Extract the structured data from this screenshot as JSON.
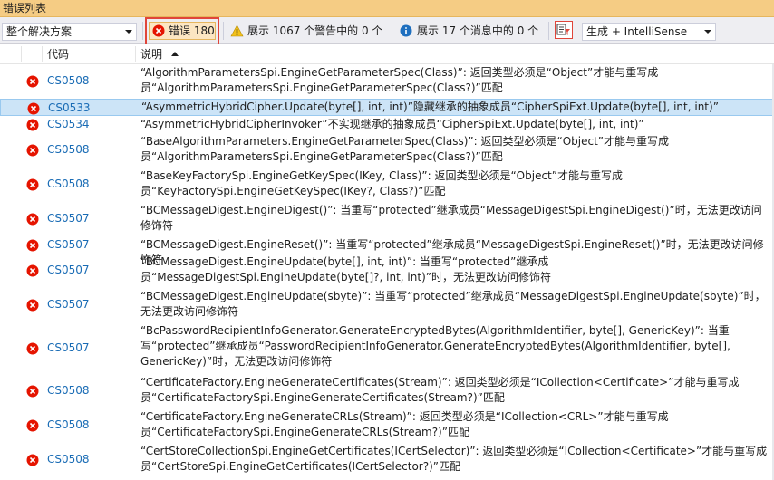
{
  "window": {
    "title": "错误列表"
  },
  "toolbar": {
    "scope_select": "整个解决方案",
    "errors_label": "错误 180",
    "warnings_label": "展示 1067 个警告中的 0 个",
    "messages_label": "展示 17 个消息中的 0 个",
    "build_select": "生成 + IntelliSense"
  },
  "columns": {
    "code": "代码",
    "description": "说明"
  },
  "colors": {
    "accent_title": "#f5cc84",
    "selected_row": "#cce4f7",
    "error_red": "#e51400",
    "link_blue": "#1a6cb5"
  },
  "rows": [
    {
      "code": "CS0508",
      "description": "“AlgorithmParametersSpi.EngineGetParameterSpec(Class)”: 返回类型必须是“Object”才能与重写成员“AlgorithmParametersSpi.EngineGetParameterSpec(Class?)”匹配"
    },
    {
      "code": "CS0533",
      "description": "“AsymmetricHybridCipher.Update(byte[], int, int)”隐藏继承的抽象成员“CipherSpiExt.Update(byte[], int, int)”"
    },
    {
      "code": "CS0534",
      "description": "“AsymmetricHybridCipherInvoker”不实现继承的抽象成员“CipherSpiExt.Update(byte[], int, int)”"
    },
    {
      "code": "CS0508",
      "description": "“BaseAlgorithmParameters.EngineGetParameterSpec(Class)”: 返回类型必须是“Object”才能与重写成员“AlgorithmParametersSpi.EngineGetParameterSpec(Class?)”匹配"
    },
    {
      "code": "CS0508",
      "description": "“BaseKeyFactorySpi.EngineGetKeySpec(IKey, Class)”: 返回类型必须是“Object”才能与重写成员“KeyFactorySpi.EngineGetKeySpec(IKey?, Class?)”匹配"
    },
    {
      "code": "CS0507",
      "description": "“BCMessageDigest.EngineDigest()”: 当重写“protected”继承成员“MessageDigestSpi.EngineDigest()”时，无法更改访问修饰符"
    },
    {
      "code": "CS0507",
      "description": "“BCMessageDigest.EngineReset()”: 当重写“protected”继承成员“MessageDigestSpi.EngineReset()”时，无法更改访问修饰符"
    },
    {
      "code": "CS0507",
      "description": "“BCMessageDigest.EngineUpdate(byte[], int, int)”: 当重写“protected”继承成员“MessageDigestSpi.EngineUpdate(byte[]?, int, int)”时，无法更改访问修饰符"
    },
    {
      "code": "CS0507",
      "description": "“BCMessageDigest.EngineUpdate(sbyte)”: 当重写“protected”继承成员“MessageDigestSpi.EngineUpdate(sbyte)”时，无法更改访问修饰符"
    },
    {
      "code": "CS0507",
      "description": "“BcPasswordRecipientInfoGenerator.GenerateEncryptedBytes(AlgorithmIdentifier, byte[], GenericKey)”: 当重写“protected”继承成员“PasswordRecipientInfoGenerator.GenerateEncryptedBytes(AlgorithmIdentifier, byte[], GenericKey)”时，无法更改访问修饰符"
    },
    {
      "code": "CS0508",
      "description": "“CertificateFactory.EngineGenerateCertificates(Stream)”: 返回类型必须是“ICollection<Certificate>”才能与重写成员“CertificateFactorySpi.EngineGenerateCertificates(Stream?)”匹配"
    },
    {
      "code": "CS0508",
      "description": "“CertificateFactory.EngineGenerateCRLs(Stream)”: 返回类型必须是“ICollection<CRL>”才能与重写成员“CertificateFactorySpi.EngineGenerateCRLs(Stream?)”匹配"
    },
    {
      "code": "CS0508",
      "description": "“CertStoreCollectionSpi.EngineGetCertificates(ICertSelector)”: 返回类型必须是“ICollection<Certificate>”才能与重写成员“CertStoreSpi.EngineGetCertificates(ICertSelector?)”匹配"
    }
  ]
}
